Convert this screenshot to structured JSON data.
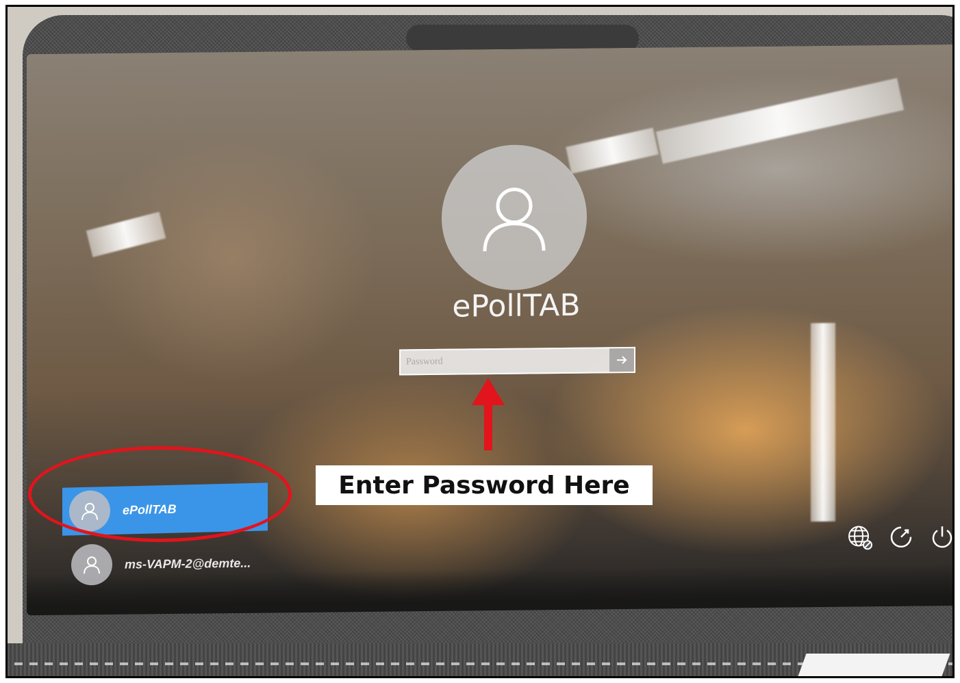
{
  "lock_screen": {
    "account_name": "ePollTAB",
    "password_placeholder": "Password"
  },
  "user_list": [
    {
      "label": "ePollTAB",
      "selected": true
    },
    {
      "label": "ms-VAPM-2@demte...",
      "selected": false
    }
  ],
  "system_icons": [
    "network-icon",
    "accessibility-icon",
    "power-icon"
  ],
  "annotation": {
    "callout_text": "Enter Password Here",
    "highlight_color": "#e2141c"
  },
  "colors": {
    "selected_user_bg": "#3a95e8"
  }
}
